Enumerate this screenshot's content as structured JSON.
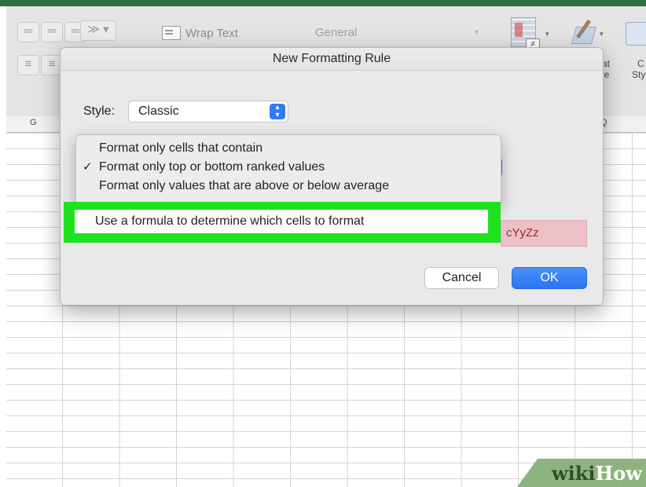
{
  "ribbon": {
    "wrap_text_label": "Wrap Text",
    "number_format_value": "General",
    "frag_1a": "at",
    "frag_1b": "le",
    "frag_2a": "C",
    "frag_2b": "Sty"
  },
  "grid": {
    "col_left": "G",
    "col_right": "Q"
  },
  "dialog": {
    "title": "New Formatting Rule",
    "style_label": "Style:",
    "style_value": "Classic",
    "menu_items": [
      {
        "label": "Format only cells that contain",
        "checked": false
      },
      {
        "label": "Format only top or bottom ranked values",
        "checked": true
      },
      {
        "label": "Format only values that are above or below average",
        "checked": false
      },
      {
        "label": "Use a formula to determine which cells to format",
        "checked": false,
        "highlighted": true
      }
    ],
    "check_glyph": "✓",
    "preview_text": "cYyZz",
    "cancel_label": "Cancel",
    "ok_label": "OK"
  },
  "watermark": {
    "part1": "wiki",
    "part2": "How"
  },
  "colors": {
    "highlight": "#1fe21f",
    "ok_button": "#2f7cf6",
    "preview_bg": "#ebc0c6"
  }
}
